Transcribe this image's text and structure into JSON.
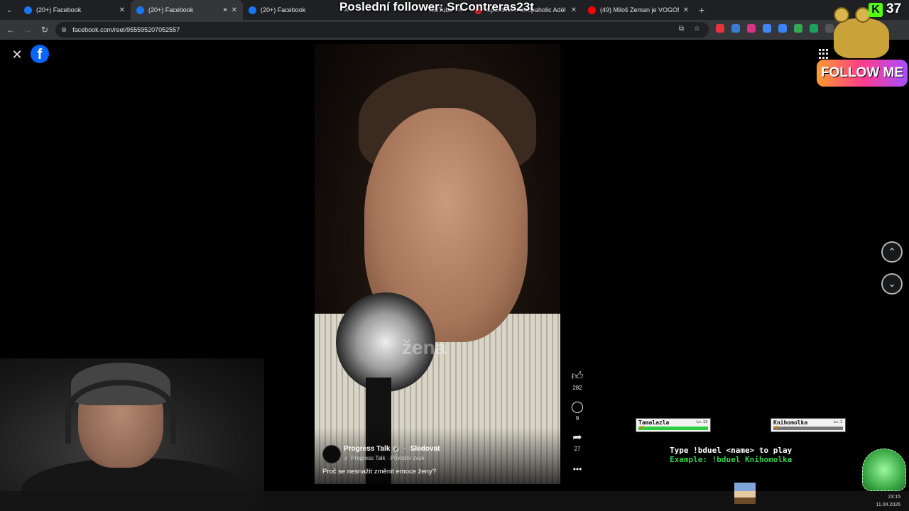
{
  "browser": {
    "tabs": [
      {
        "title": "(20+) Facebook",
        "favicon_color": "#1877f2",
        "active": false
      },
      {
        "title": "(20+) Facebook",
        "favicon_color": "#1877f2",
        "active": true
      },
      {
        "title": "(20+) Facebook",
        "favicon_color": "#1877f2",
        "active": false
      },
      {
        "title": "SportWin » Shopaholic Adél uk",
        "favicon_color": "#e02020",
        "active": false
      },
      {
        "title": "(49) Miloš Zeman je VOGON! -",
        "favicon_color": "#ff0000",
        "active": false
      }
    ],
    "youtube_tab_fragment": "YouTube",
    "new_tab_icon": "plus-icon",
    "address": {
      "url": "facebook.com/reel/955595207052557"
    },
    "extension_colors": [
      "#e8333a",
      "#3a7bd5",
      "#d63384",
      "#4285f4",
      "#3b82f6",
      "#34a853",
      "#1aa260",
      "#555555",
      "#e8a000",
      "#c8c8c8"
    ]
  },
  "overlay": {
    "follower_banner": "Poslední follower: SrContreras23t",
    "follow_button": "FOLLOW ME",
    "kick_logo": "K",
    "kick_count": "37"
  },
  "facebook": {
    "logo": "f",
    "reel": {
      "watermark": "žena",
      "author": "Progress Talk",
      "verified_mark": "✓",
      "separator": "·",
      "follow_label": "Sledovat",
      "audio": "♬ Progress Talk · Původní zvuk",
      "caption": "Proč se nesnažit změnit emoce ženy?",
      "likes": "282",
      "comments": "9",
      "shares": "27"
    }
  },
  "duel": {
    "players": [
      {
        "name": "Tamalazla",
        "level": "Lv.13",
        "hp_label": "HP",
        "hp_fraction": 1.0,
        "bar_color": "#2ecc40"
      },
      {
        "name": "Knihomolka",
        "level": "Lv.1",
        "hp_label": "HP",
        "hp_fraction": 1.0,
        "bar_color": "#777777"
      }
    ],
    "instruction": "Type !bduel <name> to play",
    "example": "Example: !bduel Knihomolka"
  },
  "clock": {
    "time": "23:15",
    "date": "11.04.2026"
  }
}
